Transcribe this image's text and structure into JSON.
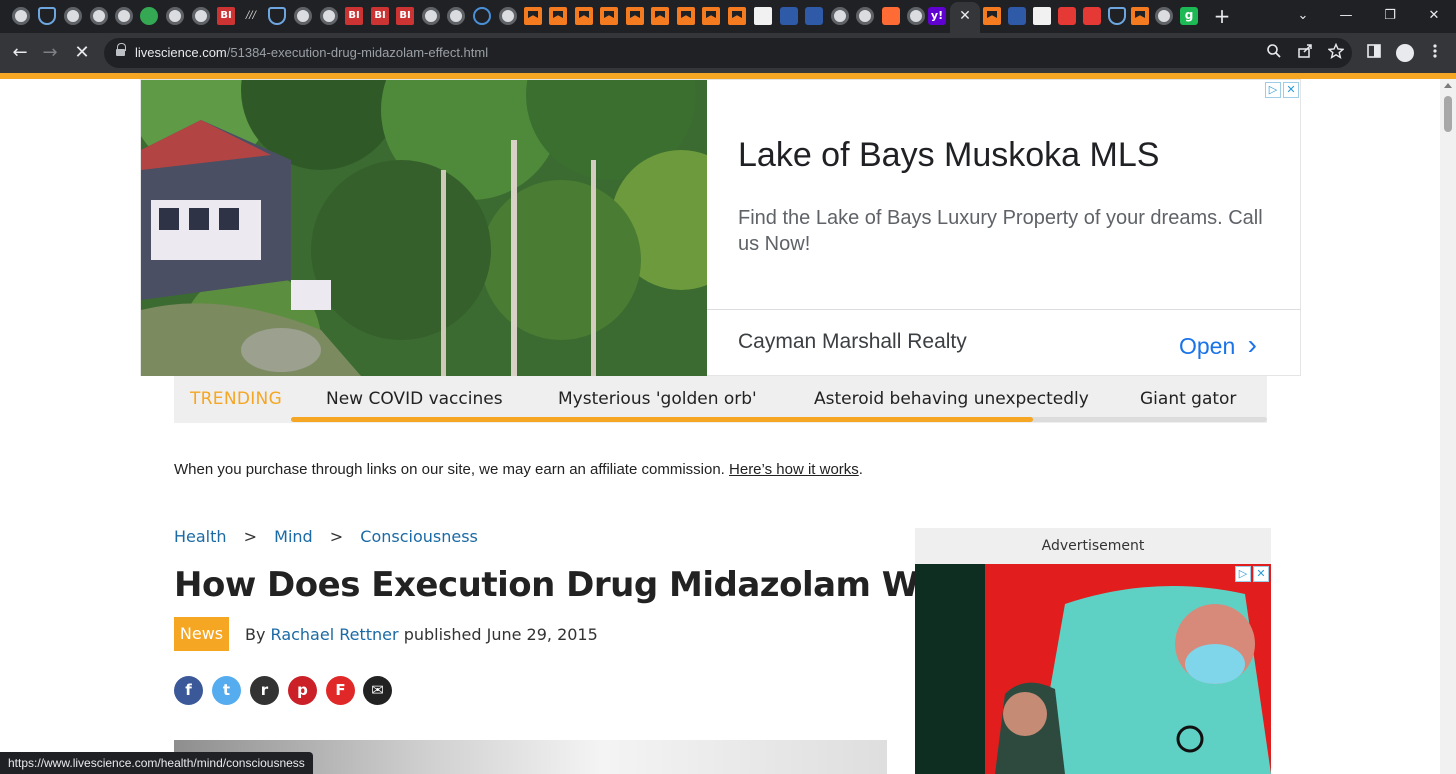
{
  "browser": {
    "url_domain": "livescience.com",
    "url_path": "/51384-execution-drug-midazolam-effect.html",
    "status_url": "https://www.livescience.com/health/mind/consciousness",
    "active_tab_close": "✕",
    "new_tab": "+",
    "window_controls": {
      "minimize": "—",
      "maximize": "❐",
      "close": "✕",
      "tab_search": "⌄"
    },
    "nav": {
      "back": "←",
      "forward": "→",
      "stop": "✕"
    },
    "icons": {
      "zoom": "zoom-icon",
      "share": "share-icon",
      "bookmark": "star-icon",
      "sidepanel": "side-panel-icon",
      "menu": "kebab-menu-icon"
    },
    "favicon_labels": {
      "bi": "BI",
      "yahoo": "y!",
      "green": "g",
      "wide": "///"
    }
  },
  "top_ad": {
    "title": "Lake of Bays Muskoka MLS",
    "description": "Find the Lake of Bays Luxury Property of your dreams. Call us Now!",
    "advertiser": "Cayman Marshall Realty",
    "cta": "Open",
    "cta_chevron": "›",
    "adchoices": "▷",
    "close": "✕"
  },
  "trending": {
    "label": "TRENDING",
    "items": [
      "New COVID vaccines",
      "Mysterious 'golden orb'",
      "Asteroid behaving unexpectedly",
      "Giant gator"
    ],
    "scroll_progress": 0.76
  },
  "affiliate": {
    "text": "When you purchase through links on our site, we may earn an affiliate commission.",
    "link": "Here’s how it works",
    "end": "."
  },
  "breadcrumb": {
    "items": [
      "Health",
      "Mind",
      "Consciousness"
    ],
    "separator": ">"
  },
  "article": {
    "title": "How Does Execution Drug Midazolam Work?",
    "badge": "News",
    "by": "By",
    "author": "Rachael Rettner",
    "published_label": "published",
    "date": "June 29, 2015"
  },
  "share": {
    "facebook": "f",
    "twitter": "t",
    "reddit": "r",
    "pinterest": "p",
    "flipboard": "F",
    "email": "✉"
  },
  "side_ad": {
    "label": "Advertisement",
    "adchoices": "▷",
    "close": "✕"
  },
  "colors": {
    "accent": "#f5a623",
    "link": "#1b6aa5",
    "ad_cta": "#1a73e8",
    "facebook": "#3b5998",
    "twitter": "#55acee",
    "reddit": "#333333",
    "pinterest": "#cb2027",
    "flipboard": "#e12828",
    "email": "#222222"
  }
}
